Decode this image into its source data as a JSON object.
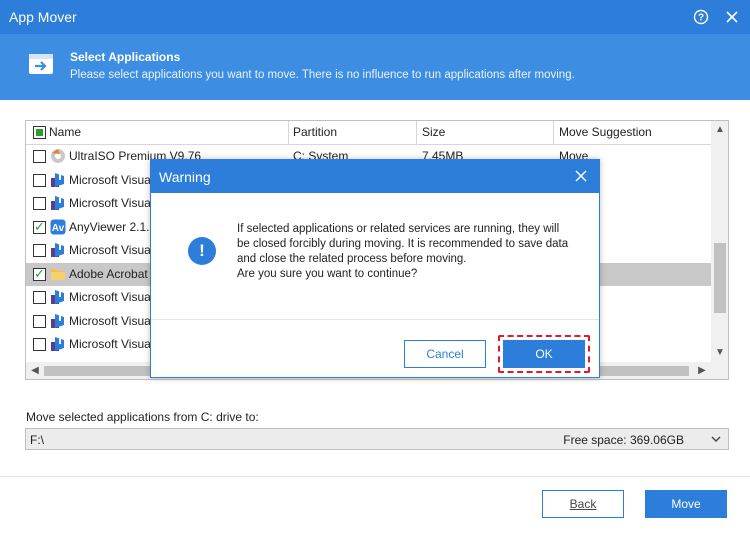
{
  "window": {
    "title": "App Mover"
  },
  "header": {
    "title": "Select Applications",
    "subtitle": "Please select applications you want to move. There is no influence to run applications after moving."
  },
  "table": {
    "columns": [
      "Name",
      "Partition",
      "Size",
      "Move Suggestion"
    ],
    "rows": [
      {
        "name": "UltraISO Premium V9.76",
        "partition": "C: System",
        "size": "7.45MB",
        "suggestion": "Move",
        "checked": false,
        "selected": false,
        "icon": "ultraiso-icon"
      },
      {
        "name": "Microsoft Visual",
        "checked": false,
        "selected": false,
        "icon": "vs-installer-icon"
      },
      {
        "name": "Microsoft Visual",
        "checked": false,
        "selected": false,
        "icon": "vs-installer-icon"
      },
      {
        "name": "AnyViewer 2.1.",
        "checked": true,
        "selected": false,
        "icon": "anyviewer-icon"
      },
      {
        "name": "Microsoft Visual",
        "checked": false,
        "selected": false,
        "icon": "vs-installer-icon"
      },
      {
        "name": "Adobe Acrobat I",
        "checked": true,
        "selected": true,
        "icon": "folder-icon"
      },
      {
        "name": "Microsoft Visual",
        "checked": false,
        "selected": false,
        "icon": "vs-installer-icon"
      },
      {
        "name": "Microsoft Visual",
        "checked": false,
        "selected": false,
        "icon": "vs-installer-icon"
      },
      {
        "name": "Microsoft Visual",
        "checked": false,
        "selected": false,
        "icon": "vs-installer-icon"
      }
    ]
  },
  "destination": {
    "label": "Move selected applications from C: drive to:",
    "value": "F:\\",
    "free_space": "Free space:  369.06GB"
  },
  "buttons": {
    "back": "Back",
    "move": "Move"
  },
  "dialog": {
    "title": "Warning",
    "message_lines": [
      "If selected applications or related services are running, they will",
      "be closed forcibly during moving. It is recommended to save data",
      "and close the related process before moving.",
      "Are you sure you want to continue?"
    ],
    "cancel": "Cancel",
    "ok": "OK"
  },
  "colors": {
    "accent": "#2d7ddb",
    "header": "#3d8ee3",
    "highlight": "#e0192d"
  }
}
